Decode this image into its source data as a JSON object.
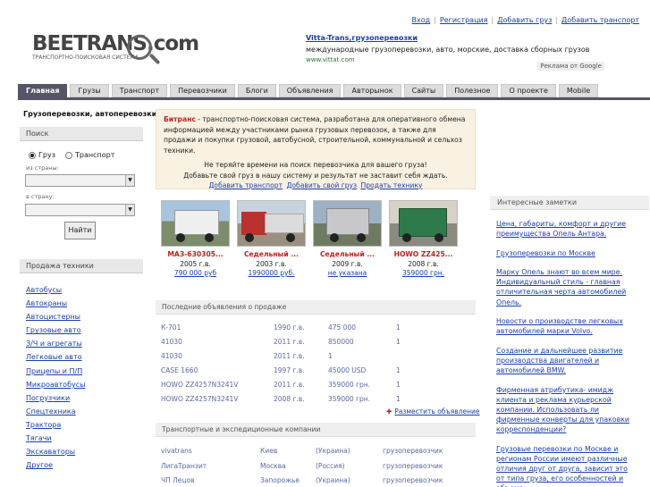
{
  "top_links": [
    "Вход",
    "Регистрация",
    "Добавить груз",
    "Добавить транспорт"
  ],
  "logo": {
    "brand": "BEETRANS.com",
    "tagline": "ТРАНСПОРТНО-ПОИСКОВАЯ СИСТЕМА"
  },
  "ad": {
    "title": "Vitta-Trans,грузоперевозки",
    "desc": "международные грузоперевозки, авто, морские, доставка сборных грузов",
    "url": "www.vittat.com",
    "label": "Реклама от Google"
  },
  "nav": [
    "Главная",
    "Грузы",
    "Транспорт",
    "Перевозчики",
    "Блоги",
    "Объявления",
    "Авторынок",
    "Сайты",
    "Полезное",
    "О проекте",
    "Mobile"
  ],
  "left": {
    "title": "Грузоперевозки, автоперевозки",
    "search": {
      "header": "Поиск",
      "radio_cargo": "Груз",
      "radio_transport": "Транспорт",
      "from_label": "из страны:",
      "to_label": "в страну:",
      "button": "Найти"
    },
    "tech_header": "Продажа техники",
    "tech_items": [
      "Автобусы",
      "Автокраны",
      "Автоцистерны",
      "Грузовые авто",
      "З/Ч и агрегаты",
      "Легковые авто",
      "Прицепы и П/П",
      "Микроавтобусы",
      "Погрузчики",
      "Спецтехника",
      "Трактора",
      "Тягачи",
      "Экскаваторы",
      "Другое"
    ]
  },
  "intro": {
    "brand": "Битранс",
    "text": " - транспортно-поисковая система, разработана для оперативного обмена информацией между участниками рынка грузовых перевозок, а также для продажи и покупки грузовой, автобусной, строительной, коммунальной и сельхоз техники.",
    "call1": "Не теряйте времени на поиск перевозчика для вашего груза!",
    "call2": "Добавьте свой груз в нашу систему и результат не заставит себя ждать.",
    "links": [
      "Добавить транспорт",
      "Добавить свой груз",
      "Продать технику"
    ]
  },
  "trucks": [
    {
      "name": "МАЗ-630305...",
      "year": "2005 г.в.",
      "price": "790 000 руб",
      "color": "#e8e8e8"
    },
    {
      "name": "Седельный ...",
      "year": "2003 г.в.",
      "price": "1990000 руб.",
      "color": "#b8322e"
    },
    {
      "name": "Седельный ...",
      "year": "2009 г.в.",
      "price": "не указана",
      "color": "#c8c8cc"
    },
    {
      "name": "HOWO ZZ425...",
      "year": "2008 г.в.",
      "price": "359000 грн.",
      "color": "#2f7a4a"
    }
  ],
  "listings_header": "Последние объявления о продаже",
  "listings": [
    {
      "name": "К-701",
      "year": "1990 г.в.",
      "price": "475 000",
      "qty": "1"
    },
    {
      "name": "41030",
      "year": "2011 г.в.",
      "price": "850000",
      "qty": "1"
    },
    {
      "name": "41030",
      "year": "2011 г.в.",
      "price": "1",
      "qty": ""
    },
    {
      "name": "CASE 1660",
      "year": "1997 г.в.",
      "price": "45000 USD",
      "qty": "1"
    },
    {
      "name": "HOWO ZZ4257N3241V",
      "year": "2011 г.в.",
      "price": "359000 грн.",
      "qty": "1"
    },
    {
      "name": "HOWO ZZ4257N3241V",
      "year": "2008 г.в.",
      "price": "359000 грн.",
      "qty": "1"
    }
  ],
  "add_ad": "Разместить объявление",
  "companies_header": "Транспортные и экспедиционные компании",
  "companies": [
    {
      "name": "vivatrans",
      "city": "Киев",
      "country": "(Украина)",
      "type": "грузоперевозчик"
    },
    {
      "name": "ЛигаТранзит",
      "city": "Москва",
      "country": "(Россия)",
      "type": "грузоперевозчик"
    },
    {
      "name": "ЧП Лецов",
      "city": "Запорожье",
      "country": "(Украина)",
      "type": "грузоперевозчик"
    }
  ],
  "notes_header": "Интересные заметки",
  "notes": [
    "Цена, габариты, комфорт и другие преимущества Опель Антара.",
    "Грузоперевозки по Москве",
    "Марку Опель знают во всем мире. Индивидуальный стиль - главная отличительная черта автомобилей Опель.",
    "Новости о производстве легковых автомобилей марки Volvo.",
    "Создание и дальнейшее развитие производства двигателей и автомобилей BMW.",
    "Фирменная атрибутика- имидж клиента и реклама курьерской компании. Использовать ли фирменные конверты для упаковки корреспонденции?",
    "Грузовые перевозки по Москве и регионам России имеют различные отличия друг от друга, зависит это от типа груза, его особенностей и объема."
  ]
}
